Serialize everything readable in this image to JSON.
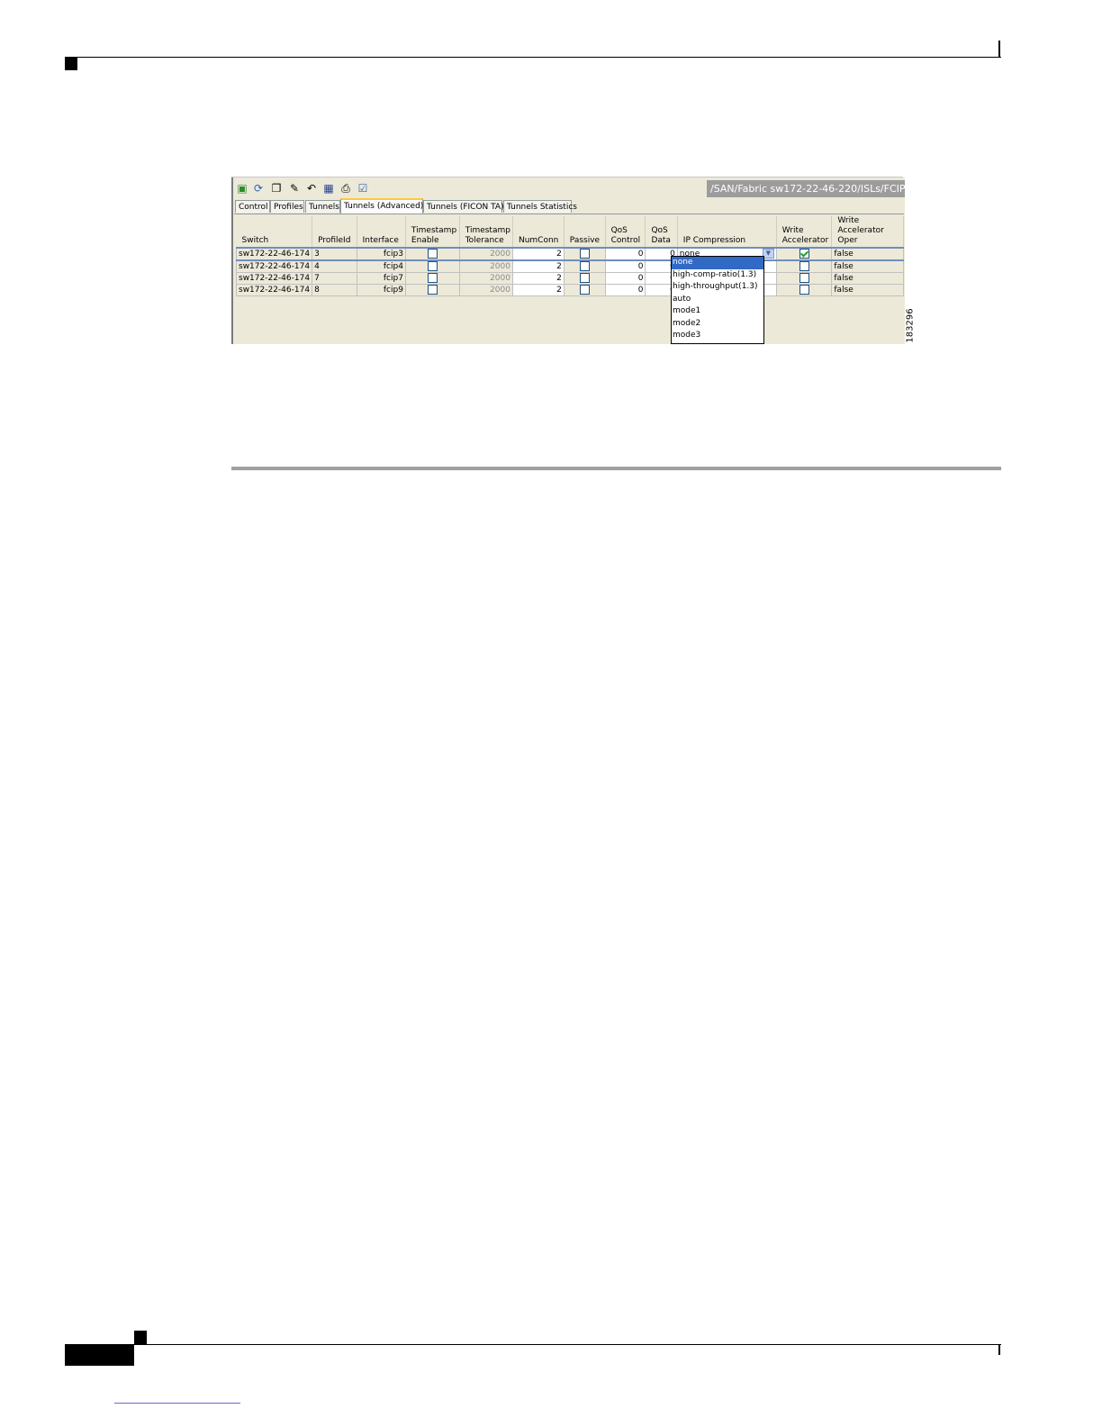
{
  "toolbar": {
    "icons": [
      "export-icon",
      "refresh-icon",
      "copy-icon",
      "paste-icon",
      "undo-icon",
      "save-icon",
      "print-icon",
      "edit-icon"
    ],
    "breadcrumb": "/SAN/Fabric sw172-22-46-220/ISLs/FCIP"
  },
  "tabs": [
    {
      "label": "Control"
    },
    {
      "label": "Profiles"
    },
    {
      "label": "Tunnels"
    },
    {
      "label": "Tunnels (Advanced)",
      "active": true
    },
    {
      "label": "Tunnels (FICON TA)"
    },
    {
      "label": "Tunnels Statistics"
    }
  ],
  "table": {
    "headers": {
      "switch": "Switch",
      "profile_id": "ProfileId",
      "interface": "Interface",
      "ts_enable_1": "Timestamp",
      "ts_enable_2": "Enable",
      "ts_tol_1": "Timestamp",
      "ts_tol_2": "Tolerance",
      "numconn": "NumConn",
      "passive": "Passive",
      "qos_control_1": "QoS",
      "qos_control_2": "Control",
      "qos_data_1": "QoS",
      "qos_data_2": "Data",
      "ip_compression": "IP Compression",
      "write_acc_1": "Write",
      "write_acc_2": "Accelerator",
      "write_acc_oper_1": "Write",
      "write_acc_oper_2": "Accelerator Oper"
    },
    "rows": [
      {
        "switch": "sw172-22-46-174",
        "profile_id": "3",
        "interface": "fcip3",
        "timestamp_enable": false,
        "tolerance": "2000",
        "numconn": "2",
        "passive": false,
        "qos_control": "0",
        "qos_data": "0",
        "ip_compression": "none",
        "write_accelerator": true,
        "write_accelerator_oper": "false"
      },
      {
        "switch": "sw172-22-46-174",
        "profile_id": "4",
        "interface": "fcip4",
        "timestamp_enable": false,
        "tolerance": "2000",
        "numconn": "2",
        "passive": false,
        "qos_control": "0",
        "qos_data": "0",
        "ip_compression": "",
        "write_accelerator": false,
        "write_accelerator_oper": "false"
      },
      {
        "switch": "sw172-22-46-174",
        "profile_id": "7",
        "interface": "fcip7",
        "timestamp_enable": false,
        "tolerance": "2000",
        "numconn": "2",
        "passive": false,
        "qos_control": "0",
        "qos_data": "0",
        "ip_compression": "",
        "write_accelerator": false,
        "write_accelerator_oper": "false"
      },
      {
        "switch": "sw172-22-46-174",
        "profile_id": "8",
        "interface": "fcip9",
        "timestamp_enable": false,
        "tolerance": "2000",
        "numconn": "2",
        "passive": false,
        "qos_control": "0",
        "qos_data": "0",
        "ip_compression": "",
        "write_accelerator": false,
        "write_accelerator_oper": "false"
      }
    ]
  },
  "ip_compression_dropdown": {
    "options": [
      "none",
      "high-comp-ratio(1.3)",
      "high-throughput(1.3)",
      "auto",
      "mode1",
      "mode2",
      "mode3"
    ],
    "selected": "none"
  },
  "figure_id": "183296",
  "colors": {
    "selection": "#316ac5",
    "tab_highlight": "#ffc83c",
    "panel_bg": "#ece9d8"
  }
}
